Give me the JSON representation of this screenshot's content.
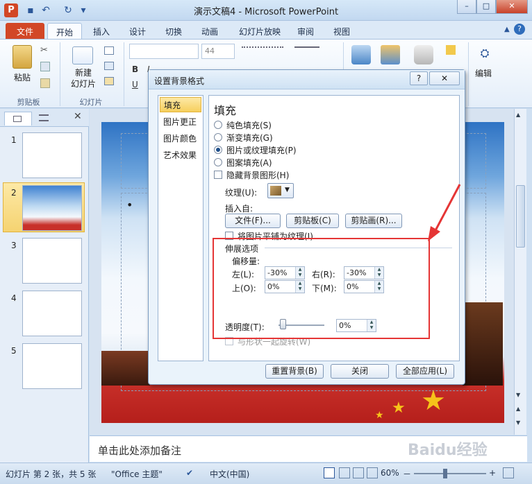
{
  "window": {
    "title": "演示文稿4 - Microsoft PowerPoint",
    "min": "–",
    "max": "□",
    "close": "✕",
    "app_letter": "P"
  },
  "qat": {
    "save": "▪",
    "undo": "↶",
    "redo": "↻",
    "more": "▾"
  },
  "tabs": [
    "文件",
    "开始",
    "插入",
    "设计",
    "切换",
    "动画",
    "幻灯片放映",
    "审阅",
    "视图"
  ],
  "ribbon": {
    "clipboard": {
      "paste": "粘贴",
      "group": "剪贴板"
    },
    "slides": {
      "new_slide": "新建\n幻灯片",
      "group": "幻灯片"
    },
    "font": {
      "size": "44",
      "bold": "B",
      "italic": "I",
      "underline": "U"
    },
    "editing": {
      "label": "编辑",
      "icon": "ñ"
    }
  },
  "slides": [
    {
      "num": "1"
    },
    {
      "num": "2"
    },
    {
      "num": "3"
    },
    {
      "num": "4"
    },
    {
      "num": "5"
    }
  ],
  "slide": {
    "bullet": "•"
  },
  "notes": {
    "placeholder": "单击此处添加备注"
  },
  "status": {
    "slide_info": "幻灯片 第 2 张，共 5 张",
    "theme": "\"Office 主题\"",
    "lang": "中文(中国)",
    "zoom": "60%",
    "minus": "－",
    "plus": "+"
  },
  "dialog": {
    "title": "设置背景格式",
    "help": "?",
    "close": "✕",
    "categories": [
      "填充",
      "图片更正",
      "图片颜色",
      "艺术效果"
    ],
    "heading": "填充",
    "fill_options": [
      "纯色填充(S)",
      "渐变填充(G)",
      "图片或纹理填充(P)",
      "图案填充(A)"
    ],
    "hide_bg": "隐藏背景图形(H)",
    "texture_label": "纹理(U):",
    "insert_from": "插入自:",
    "buttons_insert": [
      "文件(F)...",
      "剪贴板(C)",
      "剪贴画(R)..."
    ],
    "tile_label": "将图片平铺为纹理(I)",
    "stretch_title": "伸展选项",
    "offset_title": "偏移量:",
    "left_label": "左(L):",
    "left_value": "-30%",
    "right_label": "右(R):",
    "right_value": "-30%",
    "top_label": "上(O):",
    "top_value": "0%",
    "bottom_label": "下(M):",
    "bottom_value": "0%",
    "transparency_label": "透明度(T):",
    "transparency_value": "0%",
    "transparency": 0,
    "rotate_label": "与形状一起旋转(W)",
    "footer": [
      "重置背景(B)",
      "关闭",
      "全部应用(L)"
    ]
  },
  "watermark": "Baidu经验",
  "colors": {
    "file_tab": "#d24726",
    "annotation": "#e53535"
  }
}
